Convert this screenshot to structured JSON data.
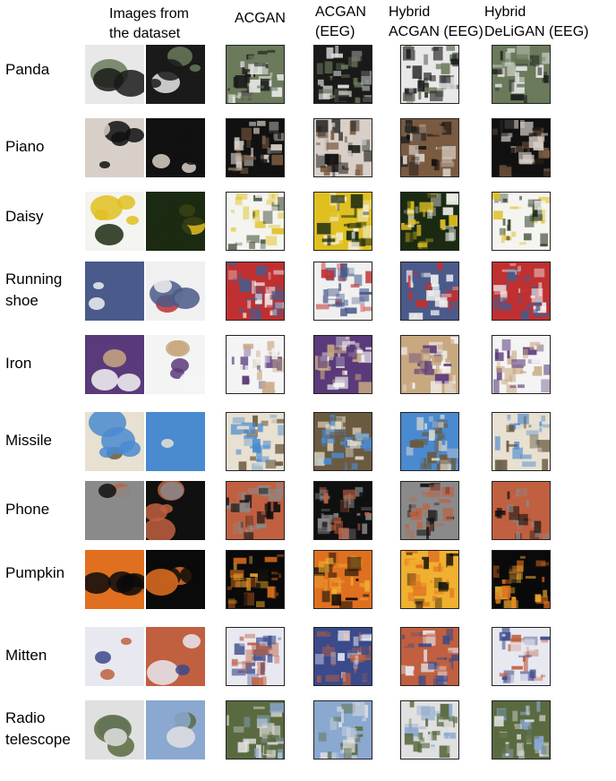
{
  "headers": {
    "dataset": "Images from\nthe dataset",
    "acgan": "ACGAN",
    "acgan_eeg": "ACGAN\n(EEG)",
    "hybrid_acgan": "Hybrid\nACGAN (EEG)",
    "hybrid_deligan": "Hybrid\nDeLiGAN (EEG)"
  },
  "rows": [
    {
      "label": "Panda",
      "palette": [
        "#1a1a1a",
        "#e8e8e8",
        "#6a7a5a"
      ]
    },
    {
      "label": "Piano",
      "palette": [
        "#111111",
        "#d8d0c8",
        "#7a5a40"
      ]
    },
    {
      "label": "Daisy",
      "palette": [
        "#1b2a12",
        "#f4f4f0",
        "#e0c020"
      ]
    },
    {
      "label": "Running\nshoe",
      "palette": [
        "#f0f0f0",
        "#4a5a8a",
        "#c03030"
      ]
    },
    {
      "label": "Iron",
      "palette": [
        "#f4f4f4",
        "#5a3a7a",
        "#c8a880"
      ]
    },
    {
      "label": "Missile",
      "palette": [
        "#4a8ad0",
        "#e8e0d0",
        "#6a5a40"
      ]
    },
    {
      "label": "Phone",
      "palette": [
        "#101010",
        "#8a8a8a",
        "#c06040"
      ]
    },
    {
      "label": "Pumpkin",
      "palette": [
        "#0a0a0a",
        "#e07020",
        "#f0b030"
      ]
    },
    {
      "label": "Mitten",
      "palette": [
        "#c06040",
        "#e8e8f0",
        "#3a4a8a"
      ]
    },
    {
      "label": "Radio\ntelescope",
      "palette": [
        "#8aa8d0",
        "#e0e0e0",
        "#5a6a40"
      ]
    }
  ]
}
